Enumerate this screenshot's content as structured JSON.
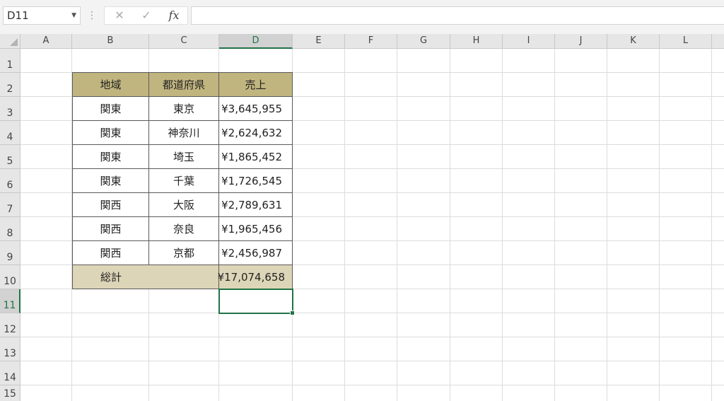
{
  "formula_bar": {
    "name_box": "D11",
    "cancel_icon": "✕",
    "enter_icon": "✓",
    "fx_label": "fx",
    "formula": ""
  },
  "columns": [
    "A",
    "B",
    "C",
    "D",
    "E",
    "F",
    "G",
    "H",
    "I",
    "J",
    "K",
    "L"
  ],
  "rows": [
    "1",
    "2",
    "3",
    "4",
    "5",
    "6",
    "7",
    "8",
    "9",
    "10",
    "11",
    "12",
    "13",
    "14",
    "15"
  ],
  "selected_cell": "D11",
  "colors": {
    "header_fill": "#c1b57f",
    "total_fill": "#ddd5b7",
    "accent": "#217346"
  },
  "table": {
    "headers": [
      "地域",
      "都道府県",
      "売上"
    ],
    "rows": [
      [
        "関東",
        "東京",
        "¥3,645,955"
      ],
      [
        "関東",
        "神奈川",
        "¥2,624,632"
      ],
      [
        "関東",
        "埼玉",
        "¥1,865,452"
      ],
      [
        "関東",
        "千葉",
        "¥1,726,545"
      ],
      [
        "関西",
        "大阪",
        "¥2,789,631"
      ],
      [
        "関西",
        "奈良",
        "¥1,965,456"
      ],
      [
        "関西",
        "京都",
        "¥2,456,987"
      ]
    ],
    "total_label": "総計",
    "total_value": "¥17,074,658"
  }
}
